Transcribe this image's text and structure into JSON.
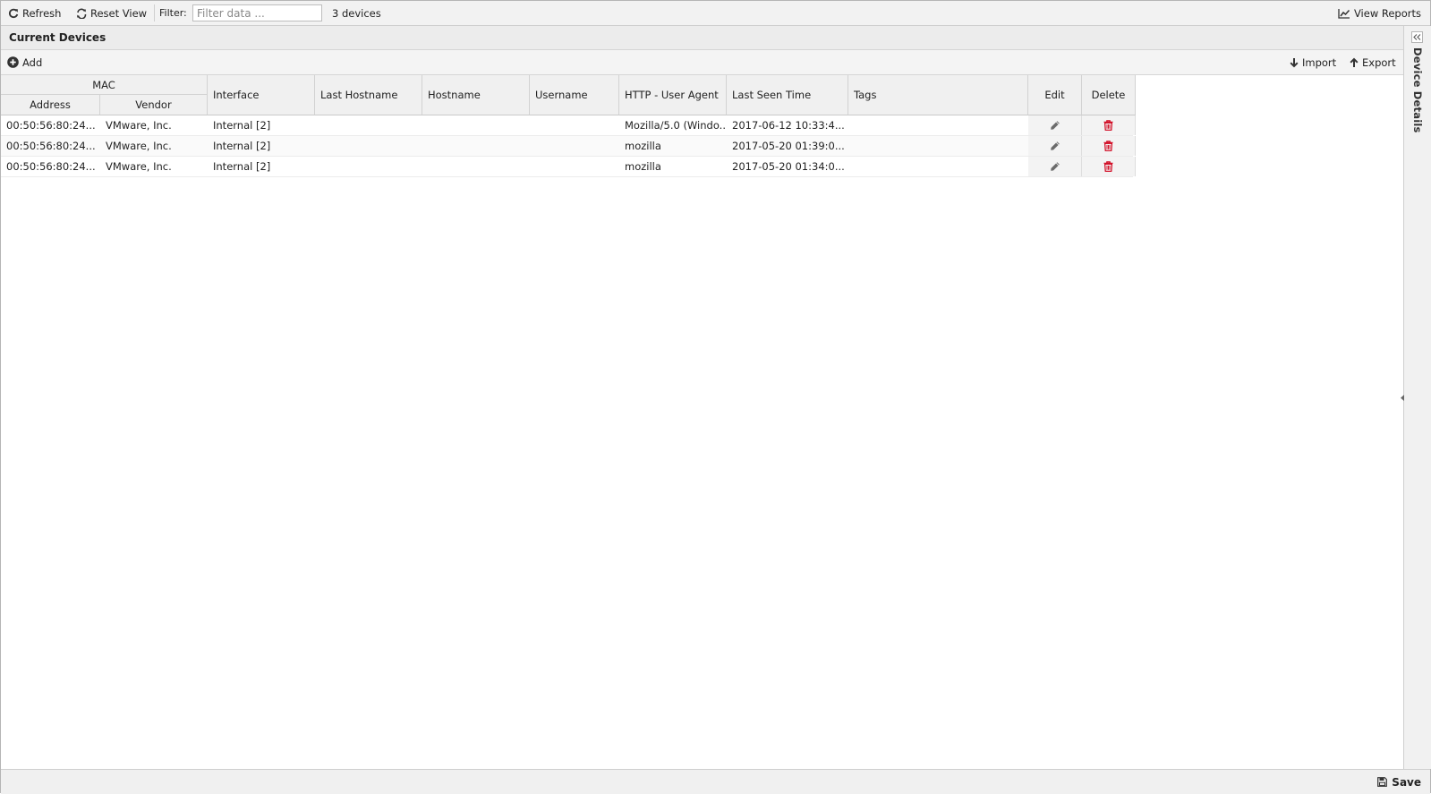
{
  "toolbar": {
    "refresh_label": "Refresh",
    "reset_view_label": "Reset View",
    "filter_label": "Filter:",
    "filter_placeholder": "Filter data ...",
    "device_count": "3 devices",
    "view_reports_label": "View Reports"
  },
  "panel": {
    "title": "Current Devices",
    "add_label": "Add",
    "import_label": "Import",
    "export_label": "Export",
    "side_panel_title": "Device Details"
  },
  "columns": {
    "mac_group": "MAC",
    "address": "Address",
    "vendor": "Vendor",
    "interface": "Interface",
    "last_hostname": "Last Hostname",
    "hostname": "Hostname",
    "username": "Username",
    "user_agent": "HTTP - User Agent",
    "last_seen": "Last Seen Time",
    "tags": "Tags",
    "edit": "Edit",
    "delete": "Delete"
  },
  "rows": [
    {
      "address": "00:50:56:80:24...",
      "vendor": "VMware, Inc.",
      "interface": "Internal [2]",
      "last_hostname": "",
      "hostname": "",
      "username": "",
      "user_agent": "Mozilla/5.0 (Windo...",
      "last_seen": "2017-06-12 10:33:4...",
      "tags": ""
    },
    {
      "address": "00:50:56:80:24...",
      "vendor": "VMware, Inc.",
      "interface": "Internal [2]",
      "last_hostname": "",
      "hostname": "",
      "username": "",
      "user_agent": "mozilla",
      "last_seen": "2017-05-20 01:39:0...",
      "tags": ""
    },
    {
      "address": "00:50:56:80:24...",
      "vendor": "VMware, Inc.",
      "interface": "Internal [2]",
      "last_hostname": "",
      "hostname": "",
      "username": "",
      "user_agent": "mozilla",
      "last_seen": "2017-05-20 01:34:0...",
      "tags": ""
    }
  ],
  "footer": {
    "save_label": "Save"
  },
  "colors": {
    "delete_icon": "#d0021b",
    "edit_icon": "#555555",
    "header_bg": "#f0f0f0"
  }
}
